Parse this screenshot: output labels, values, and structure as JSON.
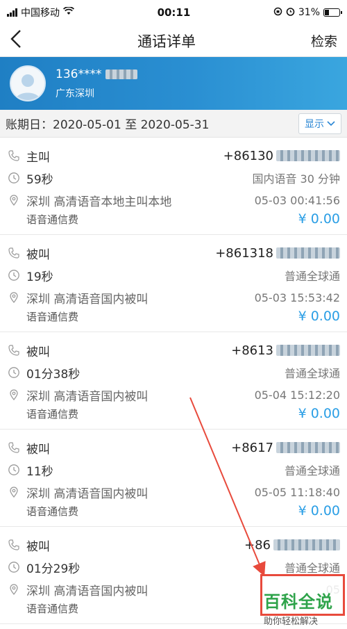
{
  "status": {
    "carrier": "中国移动",
    "time": "00:11",
    "battery": "31%",
    "battery_level": 0.31
  },
  "nav": {
    "back_icon": "chevron-left-icon",
    "title": "通话详单",
    "search": "检索"
  },
  "profile": {
    "phone": "136****",
    "city": "广东深圳"
  },
  "bill": {
    "period": "账期日：2020-05-01 至 2020-05-31",
    "show_label": "显示"
  },
  "records": [
    {
      "type": "主叫",
      "duration": "59秒",
      "location": "深圳  高清语音本地主叫本地",
      "fee_label": "语音通信费",
      "number": "+86130",
      "plan": "国内语音 30 分钟",
      "datetime": "05-03 00:41:56",
      "amount": "¥ 0.00"
    },
    {
      "type": "被叫",
      "duration": "19秒",
      "location": "深圳  高清语音国内被叫",
      "fee_label": "语音通信费",
      "number": "+861318",
      "plan": "普通全球通",
      "datetime": "05-03 15:53:42",
      "amount": "¥ 0.00"
    },
    {
      "type": "被叫",
      "duration": "01分38秒",
      "location": "深圳  高清语音国内被叫",
      "fee_label": "语音通信费",
      "number": "+8613",
      "plan": "普通全球通",
      "datetime": "05-04 15:12:20",
      "amount": "¥ 0.00"
    },
    {
      "type": "被叫",
      "duration": "11秒",
      "location": "深圳  高清语音国内被叫",
      "fee_label": "语音通信费",
      "number": "+8617",
      "plan": "普通全球通",
      "datetime": "05-05 11:18:40",
      "amount": "¥ 0.00"
    },
    {
      "type": "被叫",
      "duration": "01分29秒",
      "location": "深圳  高清语音国内被叫",
      "fee_label": "语音通信费",
      "number": "+86",
      "plan": "普通全球通",
      "datetime": "05",
      "amount": ""
    }
  ],
  "watermark": {
    "main": "百科全说",
    "sub": "助你轻松解决"
  },
  "colors": {
    "accent": "#2a9ee5",
    "header_start": "#1f7fc4",
    "header_end": "#3aa6df",
    "annotation": "#e84a3c",
    "watermark": "#2ea34a"
  }
}
